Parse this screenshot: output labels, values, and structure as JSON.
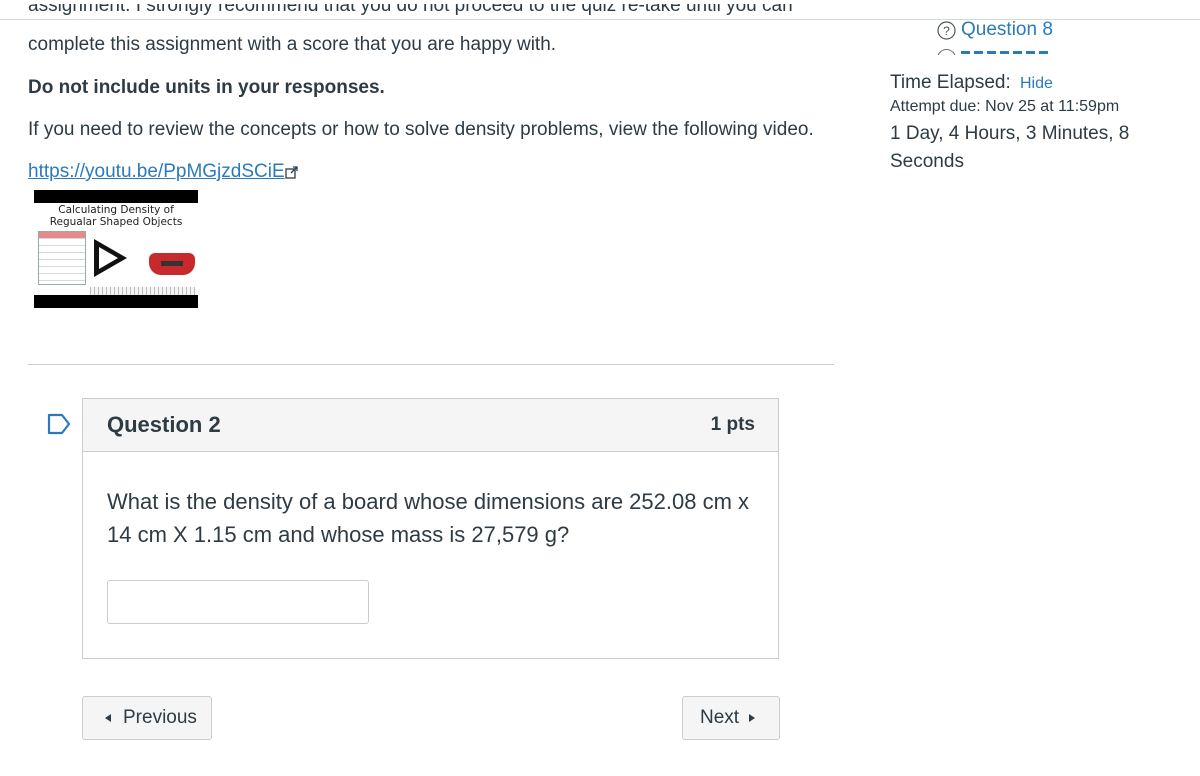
{
  "content": {
    "intro_clipped": "assignment. I strongly recommend that you do not proceed to the quiz re-take until you can",
    "intro_line2": "complete this assignment with a score that you are happy with.",
    "units_note": "Do not include units in your responses.",
    "review_note": "If you need to review the concepts or how to solve density problems, view the following video.",
    "video_link": "https://youtu.be/PpMGjzdSCiE",
    "video_thumb_title_line1": "Calculating Density of",
    "video_thumb_title_line2": "Regualar Shaped Objects"
  },
  "question": {
    "title": "Question 2",
    "points": "1 pts",
    "text": "What is the density of a board whose dimensions are 252.08 cm x 14 cm X 1.15 cm and whose mass is 27,579 g?",
    "answer_value": ""
  },
  "nav": {
    "previous_label": "Previous",
    "next_label": "Next"
  },
  "sidebar": {
    "question_link": "Question 8",
    "time_elapsed_label": "Time Elapsed:",
    "hide_label": "Hide",
    "attempt_due": "Attempt due: Nov 25 at 11:59pm",
    "time_remaining": "1 Day, 4 Hours, 3 Minutes, 8 Seconds"
  },
  "colors": {
    "link": "#2b7abc",
    "text": "#2d3b45",
    "border": "#c7cdd1"
  }
}
